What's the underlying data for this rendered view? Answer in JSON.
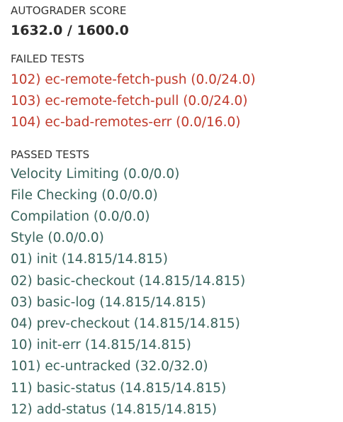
{
  "autograder": {
    "label": "AUTOGRADER SCORE",
    "score": "1632.0 / 1600.0"
  },
  "failed": {
    "label": "FAILED TESTS",
    "items": [
      "102) ec-remote-fetch-push (0.0/24.0)",
      "103) ec-remote-fetch-pull (0.0/24.0)",
      "104) ec-bad-remotes-err (0.0/16.0)"
    ]
  },
  "passed": {
    "label": "PASSED TESTS",
    "items": [
      "Velocity Limiting (0.0/0.0)",
      "File Checking (0.0/0.0)",
      "Compilation (0.0/0.0)",
      "Style (0.0/0.0)",
      "01) init (14.815/14.815)",
      "02) basic-checkout (14.815/14.815)",
      "03) basic-log (14.815/14.815)",
      "04) prev-checkout (14.815/14.815)",
      "10) init-err (14.815/14.815)",
      "101) ec-untracked (32.0/32.0)",
      "11) basic-status (14.815/14.815)",
      "12) add-status (14.815/14.815)"
    ]
  },
  "colors": {
    "failed_text": "#c0392b",
    "passed_text": "#37625b"
  }
}
